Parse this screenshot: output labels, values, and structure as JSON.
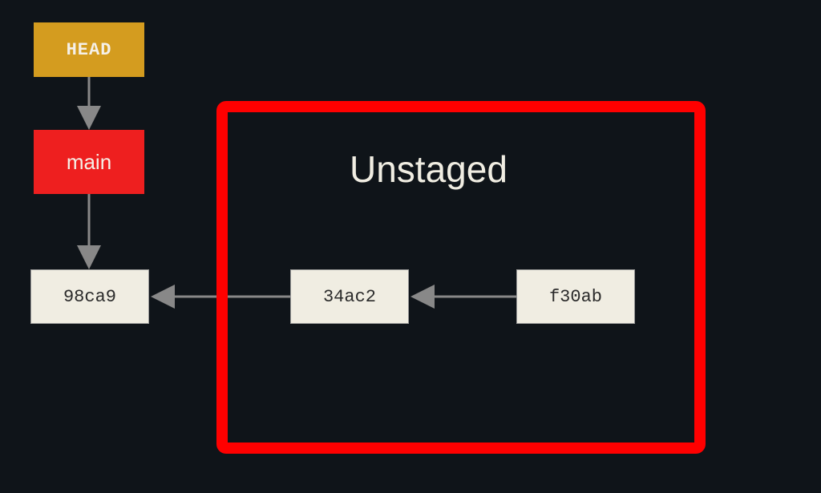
{
  "nodes": {
    "head": "HEAD",
    "branch": "main",
    "commit1": "98ca9",
    "commit2": "34ac2",
    "commit3": "f30ab"
  },
  "region": {
    "title": "Unstaged"
  },
  "colors": {
    "head_bg": "#d49c1f",
    "branch_bg": "#ee1f1f",
    "commit_bg": "#f0ede2",
    "region_border": "#ff0000",
    "background": "#0f1419",
    "arrow": "#888888"
  }
}
